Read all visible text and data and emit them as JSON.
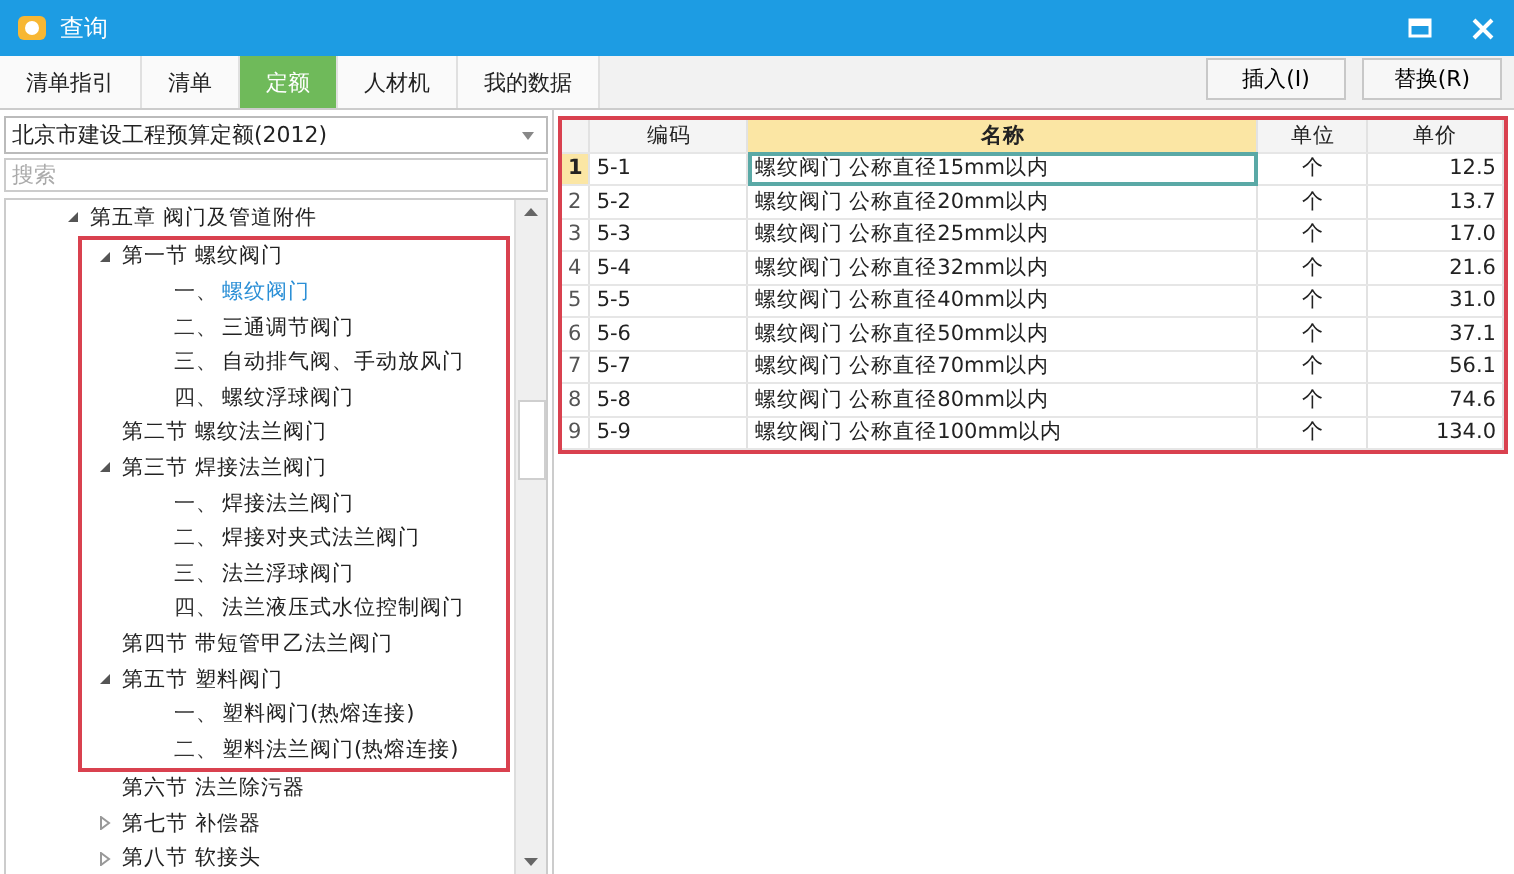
{
  "window": {
    "title": "查询"
  },
  "tabs": [
    {
      "label": "清单指引",
      "selected": false
    },
    {
      "label": "清单",
      "selected": false
    },
    {
      "label": "定额",
      "selected": true
    },
    {
      "label": "人材机",
      "selected": false
    },
    {
      "label": "我的数据",
      "selected": false
    }
  ],
  "buttons": [
    "插入(I)",
    "替换(R)"
  ],
  "library_select": {
    "value": "北京市建设工程预算定额(2012)"
  },
  "search": {
    "placeholder": "搜索"
  },
  "tree": [
    {
      "label": "第五章 阀门及管道附件",
      "expanded": true,
      "children": [
        {
          "label": "第一节 螺纹阀门",
          "expanded": true,
          "highlighted": true,
          "children": [
            {
              "number": "一、",
              "label": "螺纹阀门",
              "selected": true
            },
            {
              "number": "二、",
              "label": "三通调节阀门",
              "selected": false
            },
            {
              "number": "三、",
              "label": "自动排气阀、手动放风门",
              "selected": false
            },
            {
              "number": "四、",
              "label": "螺纹浮球阀门",
              "selected": false
            }
          ]
        },
        {
          "label": "第二节 螺纹法兰阀门",
          "highlighted": true
        },
        {
          "label": "第三节 焊接法兰阀门",
          "expanded": true,
          "highlighted": true,
          "children": [
            {
              "number": "一、",
              "label": "焊接法兰阀门",
              "selected": false
            },
            {
              "number": "二、",
              "label": "焊接对夹式法兰阀门",
              "selected": false
            },
            {
              "number": "三、",
              "label": "法兰浮球阀门",
              "selected": false
            },
            {
              "number": "四、",
              "label": "法兰液压式水位控制阀门",
              "selected": false
            }
          ]
        },
        {
          "label": "第四节 带短管甲乙法兰阀门",
          "highlighted": true
        },
        {
          "label": "第五节 塑料阀门",
          "expanded": true,
          "highlighted": true,
          "children": [
            {
              "number": "一、",
              "label": "塑料阀门(热熔连接)",
              "selected": false
            },
            {
              "number": "二、",
              "label": "塑料法兰阀门(热熔连接)",
              "selected": false
            }
          ]
        },
        {
          "label": "第六节 法兰除污器"
        },
        {
          "label": "第七节 补偿器",
          "expanded": false
        },
        {
          "label": "第八节 软接头",
          "expanded": false
        }
      ]
    }
  ],
  "table": {
    "highlighted": true,
    "columns": [
      {
        "label": "编码",
        "selected": false
      },
      {
        "label": "名称",
        "selected": true
      },
      {
        "label": "单位",
        "selected": false
      },
      {
        "label": "单价",
        "selected": false
      }
    ],
    "rows": [
      {
        "index": "1",
        "code": "5-1",
        "name": "螺纹阀门 公称直径15mm以内",
        "unit": "个",
        "price": "12.5",
        "selected": true
      },
      {
        "index": "2",
        "code": "5-2",
        "name": "螺纹阀门 公称直径20mm以内",
        "unit": "个",
        "price": "13.7",
        "selected": false
      },
      {
        "index": "3",
        "code": "5-3",
        "name": "螺纹阀门 公称直径25mm以内",
        "unit": "个",
        "price": "17.0",
        "selected": false
      },
      {
        "index": "4",
        "code": "5-4",
        "name": "螺纹阀门 公称直径32mm以内",
        "unit": "个",
        "price": "21.6",
        "selected": false
      },
      {
        "index": "5",
        "code": "5-5",
        "name": "螺纹阀门 公称直径40mm以内",
        "unit": "个",
        "price": "31.0",
        "selected": false
      },
      {
        "index": "6",
        "code": "5-6",
        "name": "螺纹阀门 公称直径50mm以内",
        "unit": "个",
        "price": "37.1",
        "selected": false
      },
      {
        "index": "7",
        "code": "5-7",
        "name": "螺纹阀门 公称直径70mm以内",
        "unit": "个",
        "price": "56.1",
        "selected": false
      },
      {
        "index": "8",
        "code": "5-8",
        "name": "螺纹阀门 公称直径80mm以内",
        "unit": "个",
        "price": "74.6",
        "selected": false
      },
      {
        "index": "9",
        "code": "5-9",
        "name": "螺纹阀门 公称直径100mm以内",
        "unit": "个",
        "price": "134.0",
        "selected": false
      }
    ]
  }
}
